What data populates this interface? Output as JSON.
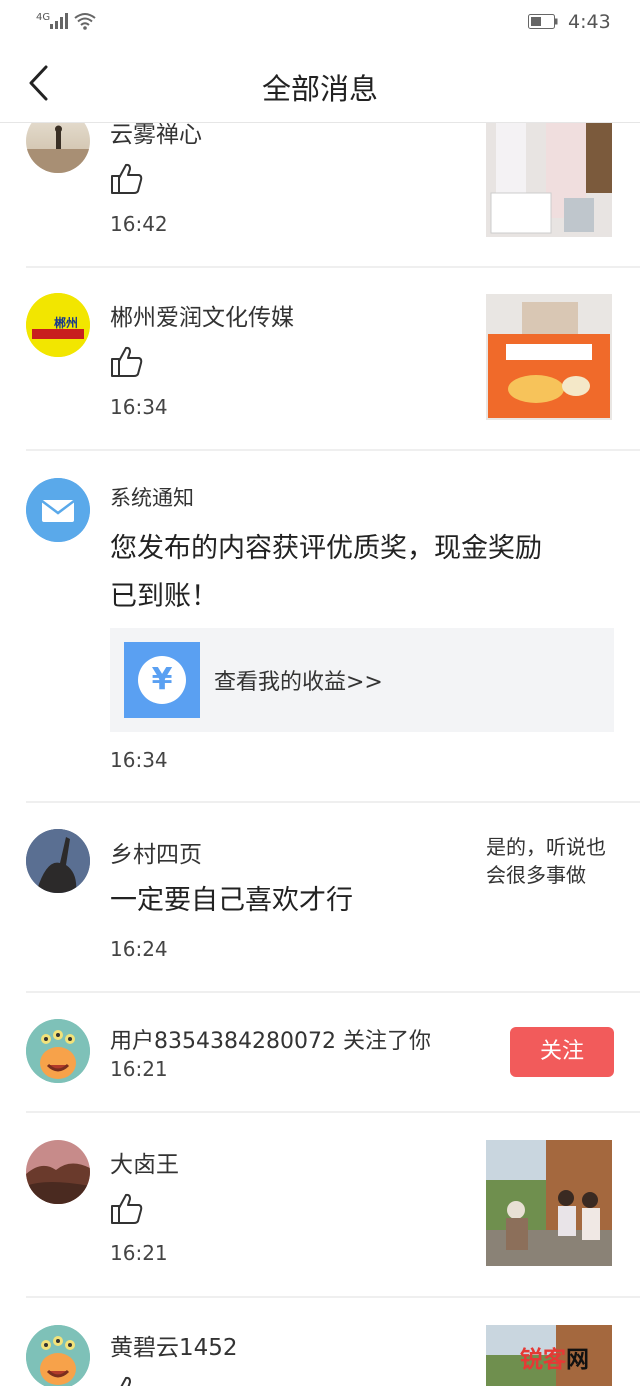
{
  "status_bar": {
    "network": "4G",
    "time": "4:43"
  },
  "nav": {
    "title": "全部消息",
    "back_icon": "chevron-left-icon"
  },
  "messages": [
    {
      "type": "like",
      "name": "云雾禅心",
      "time": "16:42",
      "thumbnail": "clothing-tags-photo"
    },
    {
      "type": "like",
      "name": "郴州爱润文化传媒",
      "time": "16:34",
      "thumbnail": "baby-food-box-photo",
      "avatar_text": "郴州"
    },
    {
      "type": "system",
      "name": "系统通知",
      "content_line1": "您发布的内容获评优质奖，现金奖励",
      "content_line2": "已到账！",
      "card_label": "查看我的收益>>",
      "card_icon_text": "¥",
      "time": "16:34"
    },
    {
      "type": "comment",
      "name": "乡村四页",
      "content": "一定要自己喜欢才行",
      "reply_line1": "是的，听说也",
      "reply_line2": "会很多事做",
      "time": "16:24"
    },
    {
      "type": "follow",
      "text": "用户8354384280072 关注了你",
      "time": "16:21",
      "button_label": "关注"
    },
    {
      "type": "like",
      "name": "大卤王",
      "time": "16:21",
      "thumbnail": "village-elders-photo"
    },
    {
      "type": "like",
      "name": "黄碧云1452",
      "thumbnail": "village-elders-photo"
    }
  ],
  "watermark": {
    "part1": "锐客",
    "part2": "网"
  },
  "colors": {
    "accent_blue": "#5aa0f2",
    "follow_red": "#f25b5b",
    "divider": "#efefef"
  }
}
